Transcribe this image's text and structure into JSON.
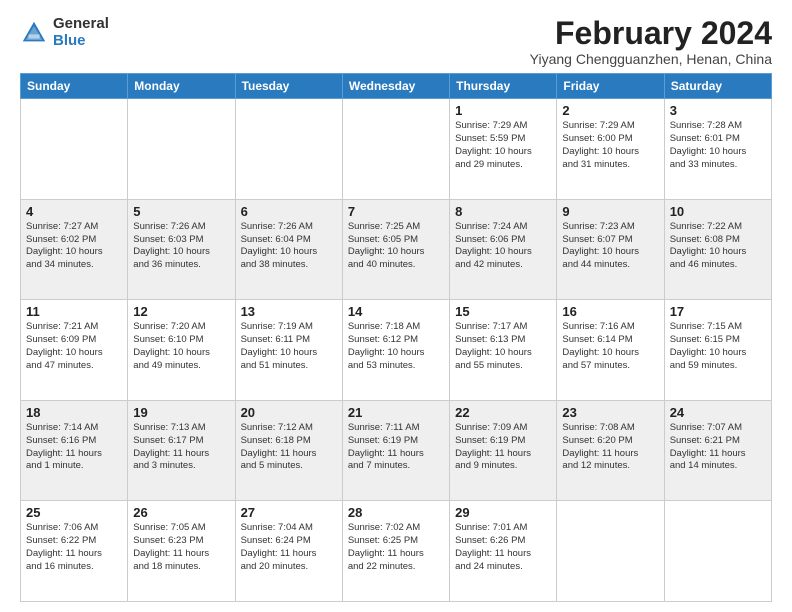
{
  "logo": {
    "general": "General",
    "blue": "Blue"
  },
  "title": "February 2024",
  "subtitle": "Yiyang Chengguanzhen, Henan, China",
  "days_of_week": [
    "Sunday",
    "Monday",
    "Tuesday",
    "Wednesday",
    "Thursday",
    "Friday",
    "Saturday"
  ],
  "weeks": [
    [
      {
        "day": "",
        "info": ""
      },
      {
        "day": "",
        "info": ""
      },
      {
        "day": "",
        "info": ""
      },
      {
        "day": "",
        "info": ""
      },
      {
        "day": "1",
        "info": "Sunrise: 7:29 AM\nSunset: 5:59 PM\nDaylight: 10 hours\nand 29 minutes."
      },
      {
        "day": "2",
        "info": "Sunrise: 7:29 AM\nSunset: 6:00 PM\nDaylight: 10 hours\nand 31 minutes."
      },
      {
        "day": "3",
        "info": "Sunrise: 7:28 AM\nSunset: 6:01 PM\nDaylight: 10 hours\nand 33 minutes."
      }
    ],
    [
      {
        "day": "4",
        "info": "Sunrise: 7:27 AM\nSunset: 6:02 PM\nDaylight: 10 hours\nand 34 minutes."
      },
      {
        "day": "5",
        "info": "Sunrise: 7:26 AM\nSunset: 6:03 PM\nDaylight: 10 hours\nand 36 minutes."
      },
      {
        "day": "6",
        "info": "Sunrise: 7:26 AM\nSunset: 6:04 PM\nDaylight: 10 hours\nand 38 minutes."
      },
      {
        "day": "7",
        "info": "Sunrise: 7:25 AM\nSunset: 6:05 PM\nDaylight: 10 hours\nand 40 minutes."
      },
      {
        "day": "8",
        "info": "Sunrise: 7:24 AM\nSunset: 6:06 PM\nDaylight: 10 hours\nand 42 minutes."
      },
      {
        "day": "9",
        "info": "Sunrise: 7:23 AM\nSunset: 6:07 PM\nDaylight: 10 hours\nand 44 minutes."
      },
      {
        "day": "10",
        "info": "Sunrise: 7:22 AM\nSunset: 6:08 PM\nDaylight: 10 hours\nand 46 minutes."
      }
    ],
    [
      {
        "day": "11",
        "info": "Sunrise: 7:21 AM\nSunset: 6:09 PM\nDaylight: 10 hours\nand 47 minutes."
      },
      {
        "day": "12",
        "info": "Sunrise: 7:20 AM\nSunset: 6:10 PM\nDaylight: 10 hours\nand 49 minutes."
      },
      {
        "day": "13",
        "info": "Sunrise: 7:19 AM\nSunset: 6:11 PM\nDaylight: 10 hours\nand 51 minutes."
      },
      {
        "day": "14",
        "info": "Sunrise: 7:18 AM\nSunset: 6:12 PM\nDaylight: 10 hours\nand 53 minutes."
      },
      {
        "day": "15",
        "info": "Sunrise: 7:17 AM\nSunset: 6:13 PM\nDaylight: 10 hours\nand 55 minutes."
      },
      {
        "day": "16",
        "info": "Sunrise: 7:16 AM\nSunset: 6:14 PM\nDaylight: 10 hours\nand 57 minutes."
      },
      {
        "day": "17",
        "info": "Sunrise: 7:15 AM\nSunset: 6:15 PM\nDaylight: 10 hours\nand 59 minutes."
      }
    ],
    [
      {
        "day": "18",
        "info": "Sunrise: 7:14 AM\nSunset: 6:16 PM\nDaylight: 11 hours\nand 1 minute."
      },
      {
        "day": "19",
        "info": "Sunrise: 7:13 AM\nSunset: 6:17 PM\nDaylight: 11 hours\nand 3 minutes."
      },
      {
        "day": "20",
        "info": "Sunrise: 7:12 AM\nSunset: 6:18 PM\nDaylight: 11 hours\nand 5 minutes."
      },
      {
        "day": "21",
        "info": "Sunrise: 7:11 AM\nSunset: 6:19 PM\nDaylight: 11 hours\nand 7 minutes."
      },
      {
        "day": "22",
        "info": "Sunrise: 7:09 AM\nSunset: 6:19 PM\nDaylight: 11 hours\nand 9 minutes."
      },
      {
        "day": "23",
        "info": "Sunrise: 7:08 AM\nSunset: 6:20 PM\nDaylight: 11 hours\nand 12 minutes."
      },
      {
        "day": "24",
        "info": "Sunrise: 7:07 AM\nSunset: 6:21 PM\nDaylight: 11 hours\nand 14 minutes."
      }
    ],
    [
      {
        "day": "25",
        "info": "Sunrise: 7:06 AM\nSunset: 6:22 PM\nDaylight: 11 hours\nand 16 minutes."
      },
      {
        "day": "26",
        "info": "Sunrise: 7:05 AM\nSunset: 6:23 PM\nDaylight: 11 hours\nand 18 minutes."
      },
      {
        "day": "27",
        "info": "Sunrise: 7:04 AM\nSunset: 6:24 PM\nDaylight: 11 hours\nand 20 minutes."
      },
      {
        "day": "28",
        "info": "Sunrise: 7:02 AM\nSunset: 6:25 PM\nDaylight: 11 hours\nand 22 minutes."
      },
      {
        "day": "29",
        "info": "Sunrise: 7:01 AM\nSunset: 6:26 PM\nDaylight: 11 hours\nand 24 minutes."
      },
      {
        "day": "",
        "info": ""
      },
      {
        "day": "",
        "info": ""
      }
    ]
  ]
}
